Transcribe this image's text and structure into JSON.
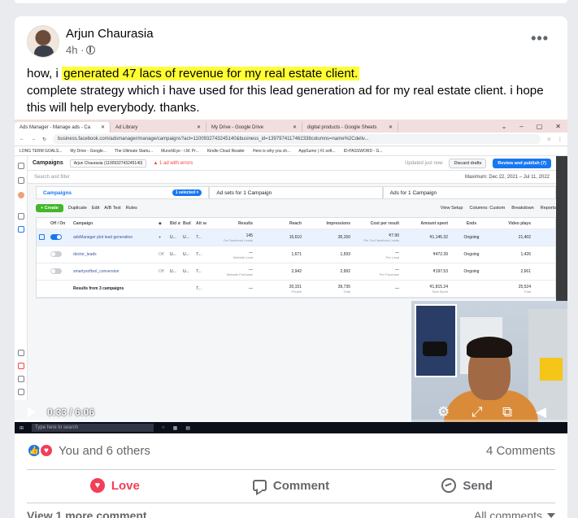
{
  "post": {
    "author": "Arjun Chaurasia",
    "time": "4h ·",
    "text_prefix": "how, i ",
    "text_highlight": "generated 47 lacs of revenue for my real estate client.",
    "text_rest": "complete strategy which i have used for this lead generation ad for my real estate client. i hope this will help everybody. thanks.",
    "more": "•••"
  },
  "browser": {
    "tabs": [
      "Ads Manager - Manage ads - Ca",
      "Ad Library",
      "My Drive - Google Drive",
      "digital products - Google Sheets"
    ],
    "url": "business.facebook.com/adsmanager/manage/campaigns?act=1100932743245140&business_id=1397974117462338columns=name%2Cdeliv...",
    "bookmarks": [
      "LONG TERM GOALS...",
      "My Drive - Google...",
      "The Ultimate Startu...",
      "MunchEye - I.M. Pr...",
      "Kindle Cloud Reader",
      "Here is why you sh...",
      "AppSumo | #1 soft...",
      "ID-PASSWORD - G..."
    ]
  },
  "ads_manager": {
    "title": "Campaigns",
    "account": "Arjun Chaurasia (1100932743245140)",
    "error": "1 ad with errors",
    "updated": "Updated just now",
    "discard": "Discard drafts",
    "publish": "Review and publish (7)",
    "search_placeholder": "Search and filter",
    "date_range": "Maximum: Dec 22, 2021 – Jul 11, 2022",
    "tab_campaigns": "Campaigns",
    "selected": "1 selected ×",
    "tab_adsets": "Ad sets for 1 Campaign",
    "tab_ads": "Ads for 1 Campaign",
    "create": "+ Create",
    "duplicate": "Duplicate",
    "edit": "Edit",
    "abtest": "A/B Test",
    "rules": "Rules",
    "view_setup": "View Setup",
    "columns": "Columns: Custom",
    "breakdown": "Breakdown",
    "reports": "Reports",
    "headers": [
      "Off / On",
      "Campaign",
      "Bid strat",
      "Bud",
      "Att setti",
      "Results",
      "Reach",
      "Impressions",
      "Cost per result",
      "Amount spent",
      "Ends",
      "Video plays"
    ],
    "rows": [
      {
        "name": "adsManager plot lead generation",
        "bid": "U...",
        "bud": "U...",
        "att": "7...",
        "results": "145",
        "results_sub": "On-Facebook Leads",
        "reach": "15,610",
        "impr": "35,150",
        "cpr": "₹7.90",
        "cpr_sub": "Per On-Facebook Leads",
        "amount": "₹1,145.32",
        "ends": "Ongoing",
        "plays": "21,402"
      },
      {
        "name": "doctor_leads",
        "bid": "U...",
        "bud": "U...",
        "att": "7...",
        "results": "—",
        "results_sub": "Website Lead",
        "reach": "1,671",
        "impr": "1,593",
        "cpr": "—",
        "cpr_sub": "Per Lead",
        "amount": "₹472.39",
        "ends": "Ongoing",
        "plays": "1,426"
      },
      {
        "name": "smartysoftsol_conversion",
        "bid": "U...",
        "bud": "U...",
        "att": "7...",
        "results": "—",
        "results_sub": "Website Purchase",
        "reach": "2,942",
        "impr": "2,992",
        "cpr": "—",
        "cpr_sub": "Per Purchase",
        "amount": "₹197.53",
        "ends": "Ongoing",
        "plays": "2,661"
      }
    ],
    "total": {
      "label": "Results from 3 campaigns",
      "att": "7...",
      "results": "—",
      "reach": "20,151",
      "reach_sub": "People",
      "impr": "39,735",
      "impr_sub": "Total",
      "cpr": "—",
      "amount": "₹1,815.24",
      "amount_sub": "Total Spent",
      "plays": "25,524",
      "plays_sub": "Total"
    }
  },
  "video": {
    "time": "0:33 / 6:06",
    "progress": 0.09,
    "taskbar_search": "Type here to search"
  },
  "reactions": {
    "summary": "You and 6 others",
    "comments": "4 Comments"
  },
  "actions": {
    "love": "Love",
    "comment": "Comment",
    "send": "Send"
  },
  "footer": {
    "view_more": "View 1 more comment",
    "sort": "All comments"
  },
  "colors": {
    "accent": "#1877f2",
    "love": "#f33e58",
    "highlight": "#ffff33"
  }
}
